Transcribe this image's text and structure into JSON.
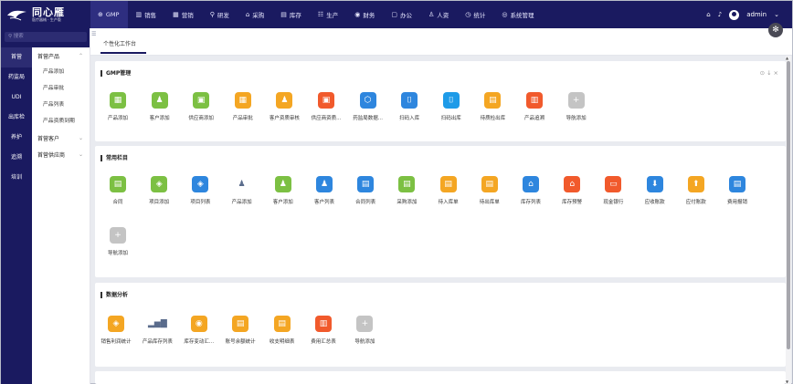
{
  "brand": {
    "name": "同心雁",
    "sub": "医疗器械 · 生产版"
  },
  "nav": [
    {
      "label": "GMP",
      "icon": "gmp-icon",
      "glyph": "⊕",
      "active": true
    },
    {
      "label": "销售",
      "icon": "sales-icon",
      "glyph": "▥"
    },
    {
      "label": "营销",
      "icon": "marketing-icon",
      "glyph": "▦"
    },
    {
      "label": "研发",
      "icon": "rnd-icon",
      "glyph": "⚲"
    },
    {
      "label": "采购",
      "icon": "purchase-icon",
      "glyph": "⌂"
    },
    {
      "label": "库存",
      "icon": "stock-icon",
      "glyph": "▤"
    },
    {
      "label": "生产",
      "icon": "production-icon",
      "glyph": "☷"
    },
    {
      "label": "财务",
      "icon": "finance-icon",
      "glyph": "◉"
    },
    {
      "label": "办公",
      "icon": "office-icon",
      "glyph": "▢"
    },
    {
      "label": "人资",
      "icon": "hr-icon",
      "glyph": "♙"
    },
    {
      "label": "统计",
      "icon": "stats-icon",
      "glyph": "◷"
    },
    {
      "label": "系统管理",
      "icon": "system-icon",
      "glyph": "◎"
    }
  ],
  "user": {
    "name": "admin"
  },
  "search": {
    "placeholder": "搜索"
  },
  "rail": [
    "首营",
    "药监局",
    "UDI",
    "出库检",
    "养护",
    "追溯",
    "培训"
  ],
  "submenu": {
    "groups": [
      {
        "label": "首营产品",
        "children": [
          "产品添加",
          "产品审批",
          "产品列表",
          "产品资质到期"
        ]
      },
      {
        "label": "首营客户",
        "children": []
      },
      {
        "label": "首营供应商",
        "children": []
      }
    ]
  },
  "tab": {
    "label": "个性化工作台"
  },
  "panels": {
    "gmp": {
      "title": "GMP管理",
      "items": [
        {
          "label": "产品添加",
          "color": "#7cc043",
          "icon": "grid-icon",
          "glyph": "▦"
        },
        {
          "label": "客户添加",
          "color": "#7cc043",
          "icon": "user-add-icon",
          "glyph": "♟"
        },
        {
          "label": "供应商添加",
          "color": "#7cc043",
          "icon": "supplier-icon",
          "glyph": "▣"
        },
        {
          "label": "产品审批",
          "color": "#f4a623",
          "icon": "approve-icon",
          "glyph": "▦"
        },
        {
          "label": "客户资质审核",
          "color": "#f4a623",
          "icon": "customer-cert-icon",
          "glyph": "♟"
        },
        {
          "label": "供应商资质...",
          "color": "#f15a2c",
          "icon": "supplier-cert-icon",
          "glyph": "▣"
        },
        {
          "label": "药监局数据...",
          "color": "#2e86de",
          "icon": "fda-data-icon",
          "glyph": "⬡"
        },
        {
          "label": "扫码入库",
          "color": "#2e86de",
          "icon": "scan-in-icon",
          "glyph": "⌷"
        },
        {
          "label": "扫码出库",
          "color": "#1e9be8",
          "icon": "scan-out-icon",
          "glyph": "⌷"
        },
        {
          "label": "待质检出库",
          "color": "#f4a623",
          "icon": "qc-out-icon",
          "glyph": "▤"
        },
        {
          "label": "产品追溯",
          "color": "#f15a2c",
          "icon": "trace-icon",
          "glyph": "▥"
        },
        {
          "label": "导航添加",
          "color": "#c4c4c4",
          "icon": "plus-icon",
          "glyph": "+"
        }
      ]
    },
    "common": {
      "title": "常用栏目",
      "items": [
        {
          "label": "合同",
          "color": "#7cc043",
          "icon": "contract-icon",
          "glyph": "▤"
        },
        {
          "label": "项目添加",
          "color": "#7cc043",
          "icon": "project-add-icon",
          "glyph": "◈"
        },
        {
          "label": "项目列表",
          "color": "#2e86de",
          "icon": "project-list-icon",
          "glyph": "◈"
        },
        {
          "label": "产品添加",
          "color": "#ffffff",
          "icon": "person-icon",
          "glyph": "♟"
        },
        {
          "label": "客户添加",
          "color": "#7cc043",
          "icon": "customer-add-icon",
          "glyph": "♟"
        },
        {
          "label": "客户列表",
          "color": "#2e86de",
          "icon": "customer-list-icon",
          "glyph": "♟"
        },
        {
          "label": "合同列表",
          "color": "#2e86de",
          "icon": "contract-list-icon",
          "glyph": "▤"
        },
        {
          "label": "采购添加",
          "color": "#7cc043",
          "icon": "purchase-add-icon",
          "glyph": "▤"
        },
        {
          "label": "待入库单",
          "color": "#f4a623",
          "icon": "pending-in-icon",
          "glyph": "▤"
        },
        {
          "label": "待出库单",
          "color": "#f4a623",
          "icon": "pending-out-icon",
          "glyph": "▤"
        },
        {
          "label": "库存列表",
          "color": "#2e86de",
          "icon": "stock-list-icon",
          "glyph": "⌂"
        },
        {
          "label": "库存预警",
          "color": "#f15a2c",
          "icon": "stock-alert-icon",
          "glyph": "⌂"
        },
        {
          "label": "现金银行",
          "color": "#f15a2c",
          "icon": "bank-icon",
          "glyph": "▭"
        },
        {
          "label": "应收账款",
          "color": "#2e86de",
          "icon": "receivable-icon",
          "glyph": "⬇"
        },
        {
          "label": "应付账款",
          "color": "#f4a623",
          "icon": "payable-icon",
          "glyph": "⬆"
        },
        {
          "label": "费用报销",
          "color": "#2e86de",
          "icon": "expense-icon",
          "glyph": "▤"
        },
        {
          "label": "导航添加",
          "color": "#c4c4c4",
          "icon": "plus-icon",
          "glyph": "+"
        }
      ]
    },
    "analysis": {
      "title": "数据分析",
      "items": [
        {
          "label": "销售利润统计",
          "color": "#f4a623",
          "icon": "profit-icon",
          "glyph": "◈"
        },
        {
          "label": "产品库存列表",
          "color": "#ffffff",
          "icon": "bar-chart-icon",
          "glyph": "▂▅▇"
        },
        {
          "label": "库存变动汇...",
          "color": "#f4a623",
          "icon": "stock-change-icon",
          "glyph": "◉"
        },
        {
          "label": "账号余额统计",
          "color": "#f4a623",
          "icon": "balance-icon",
          "glyph": "▤"
        },
        {
          "label": "收支明细表",
          "color": "#f4a623",
          "icon": "income-icon",
          "glyph": "▤"
        },
        {
          "label": "费用汇总表",
          "color": "#f15a2c",
          "icon": "expense-summary-icon",
          "glyph": "▥"
        },
        {
          "label": "导航添加",
          "color": "#c4c4c4",
          "icon": "plus-icon",
          "glyph": "+"
        }
      ]
    }
  },
  "colors": {
    "topbar": "#1a1a60",
    "accent": "#1a1a60"
  }
}
